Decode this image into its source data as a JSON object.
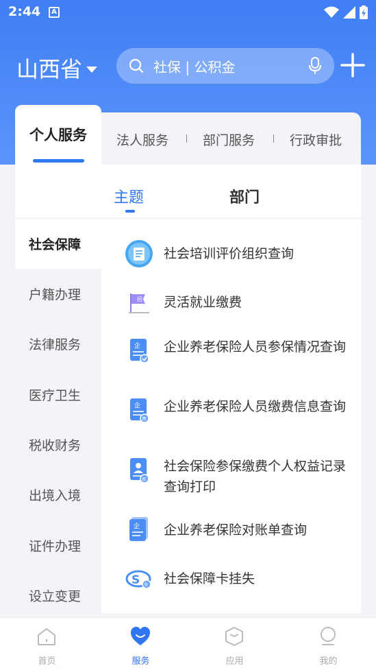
{
  "status": {
    "time": "2:44",
    "notif_letter": "A"
  },
  "header": {
    "province": "山西省",
    "search_placeholder": "社保 | 公积金"
  },
  "tabs": [
    {
      "label": "个人服务"
    },
    {
      "label": "法人服务"
    },
    {
      "label": "部门服务"
    },
    {
      "label": "行政审批"
    }
  ],
  "subtabs": {
    "active": "主题",
    "inactive": "部门"
  },
  "categories": [
    {
      "label": "社会保障"
    },
    {
      "label": "户籍办理"
    },
    {
      "label": "法律服务"
    },
    {
      "label": "医疗卫生"
    },
    {
      "label": "税收财务"
    },
    {
      "label": "出境入境"
    },
    {
      "label": "证件办理"
    },
    {
      "label": "设立变更"
    }
  ],
  "services": [
    {
      "label": "社会培训评价组织查询",
      "icon": "checklist-circle-icon"
    },
    {
      "label": "灵活就业缴费",
      "icon": "recruit-flag-icon"
    },
    {
      "label": "企业养老保险人员参保情况查询",
      "icon": "enterprise-doc-check-icon"
    },
    {
      "label": "企业养老保险人员缴费信息查询",
      "icon": "enterprise-doc-fee-icon"
    },
    {
      "label": "社会保险参保缴费个人权益记录查询打印",
      "icon": "person-doc-icon"
    },
    {
      "label": "企业养老保险对账单查询",
      "icon": "enterprise-statement-icon"
    },
    {
      "label": "社会保障卡挂失",
      "icon": "social-security-card-icon"
    }
  ],
  "service_icon_badges": {
    "recruit": "招",
    "enterprise": "企",
    "fee": "费",
    "person": "权",
    "lost": "失"
  },
  "bottom_nav": [
    {
      "label": "首页"
    },
    {
      "label": "服务"
    },
    {
      "label": "应用"
    },
    {
      "label": "我的"
    }
  ],
  "colors": {
    "primary": "#2f76f2",
    "header_top": "#3f7ef5",
    "header_bottom": "#5b95fa"
  }
}
